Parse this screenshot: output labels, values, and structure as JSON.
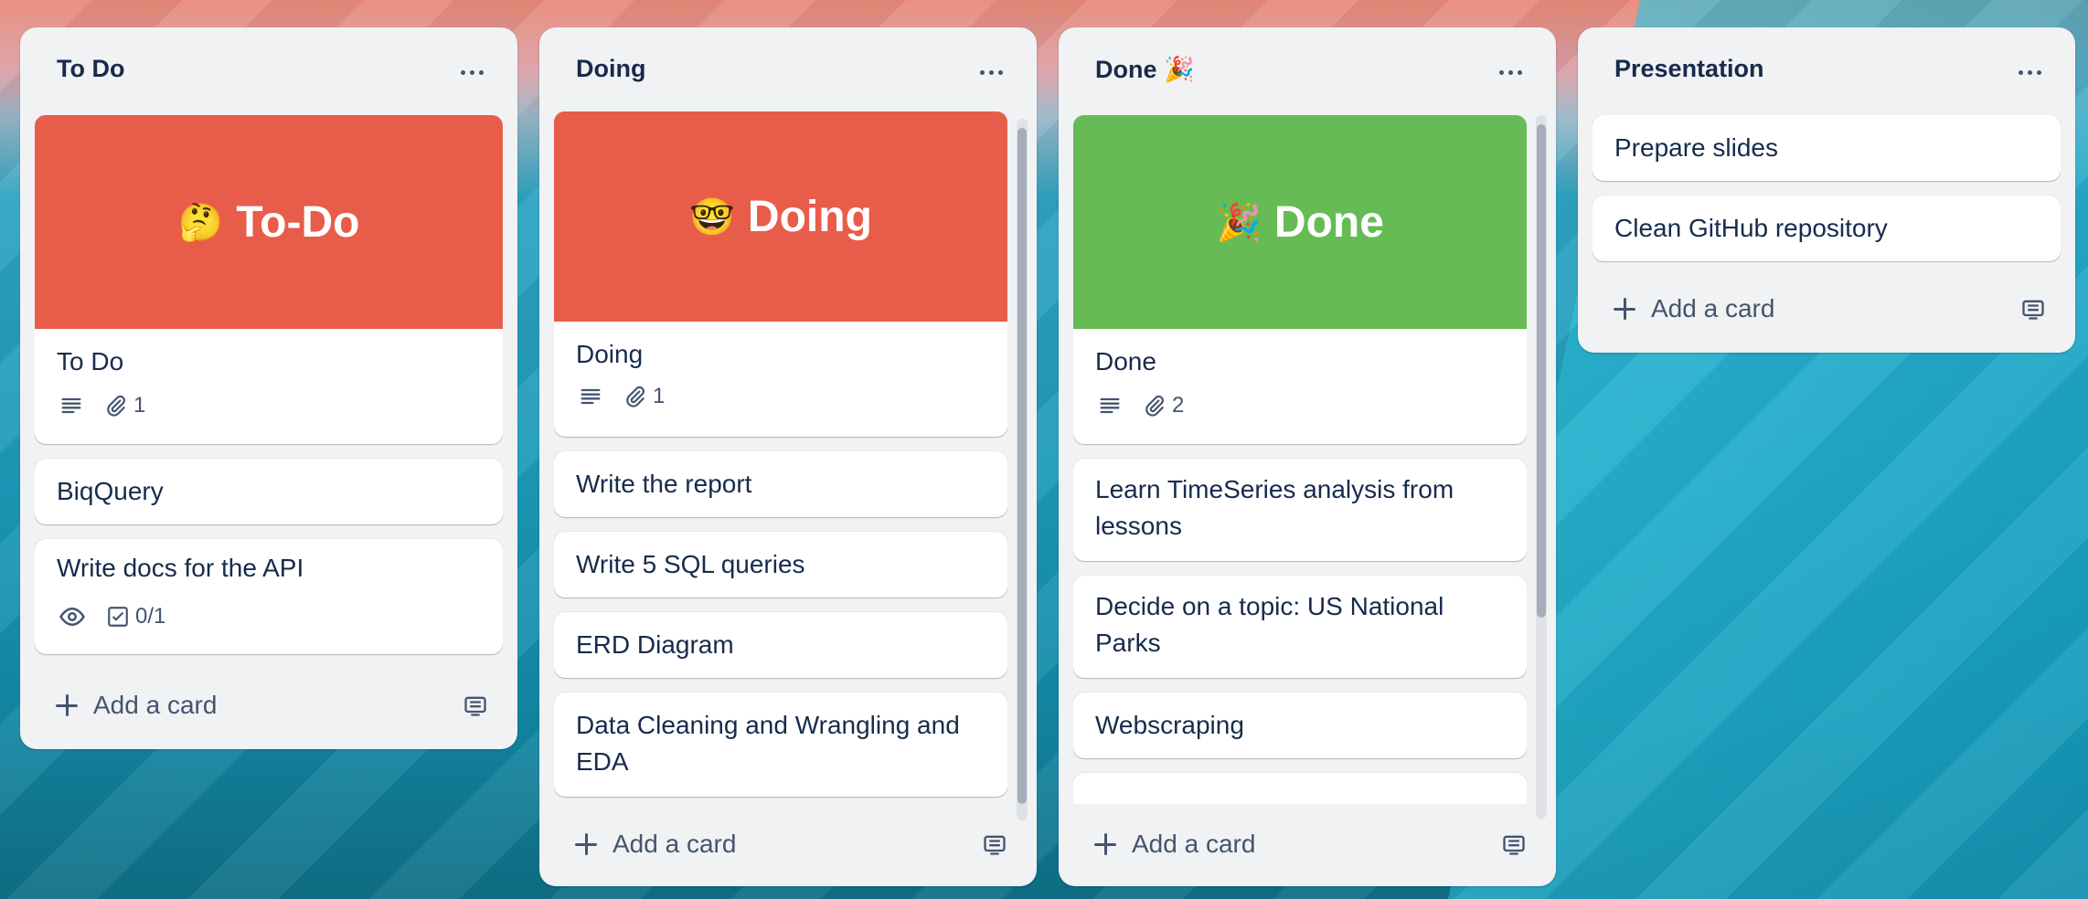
{
  "lists": [
    {
      "title": "To Do",
      "cards": [
        {
          "cover_emoji": "🤔",
          "cover_text": "To-Do",
          "cover_color": "#e85c4a",
          "title": "To Do",
          "attachments": "1"
        },
        {
          "title": "BiqQuery"
        },
        {
          "title": "Write docs for the API",
          "checklist": "0/1"
        }
      ],
      "add_card_label": "Add a card"
    },
    {
      "title": "Doing",
      "cards": [
        {
          "cover_emoji": "🤓",
          "cover_text": "Doing",
          "cover_color": "#e85c4a",
          "title": "Doing",
          "attachments": "1"
        },
        {
          "title": "Write the report"
        },
        {
          "title": "Write 5 SQL queries"
        },
        {
          "title": "ERD Diagram"
        },
        {
          "title": "Data Cleaning and Wrangling and EDA"
        }
      ],
      "add_card_label": "Add a card"
    },
    {
      "title": "Done 🎉",
      "cards": [
        {
          "cover_emoji": "🎉",
          "cover_text": "Done",
          "cover_color": "#66bb55",
          "title": "Done",
          "attachments": "2"
        },
        {
          "title": "Learn TimeSeries analysis from lessons"
        },
        {
          "title": "Decide on a topic: US National Parks"
        },
        {
          "title": "Webscraping"
        }
      ],
      "add_card_label": "Add a card"
    },
    {
      "title": "Presentation",
      "cards": [
        {
          "title": "Prepare slides"
        },
        {
          "title": "Clean GitHub repository"
        }
      ],
      "add_card_label": "Add a card"
    }
  ],
  "icons": {
    "menu": "more-horizontal-icon",
    "description": "description-icon",
    "attachment": "paperclip-icon",
    "watch": "eye-icon",
    "checklist": "checkbox-icon",
    "add": "plus-icon",
    "template": "template-icon"
  }
}
